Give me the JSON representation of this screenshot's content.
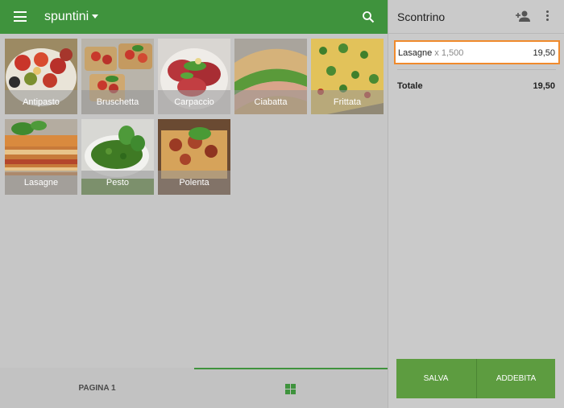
{
  "appbar": {
    "category": "spuntini"
  },
  "products": [
    {
      "name": "Antipasto"
    },
    {
      "name": "Bruschetta"
    },
    {
      "name": "Carpaccio"
    },
    {
      "name": "Ciabatta"
    },
    {
      "name": "Frittata"
    },
    {
      "name": "Lasagne"
    },
    {
      "name": "Pesto"
    },
    {
      "name": "Polenta"
    }
  ],
  "bottom": {
    "page_label": "PAGINA 1"
  },
  "receipt": {
    "title": "Scontrino",
    "items": [
      {
        "name": "Lasagne",
        "qty": "x 1,500",
        "price": "19,50"
      }
    ],
    "total_label": "Totale",
    "total_value": "19,50"
  },
  "actions": {
    "save_label": "SALVA",
    "charge_label": "ADDEBITA"
  },
  "colors": {
    "primary": "#3f933d",
    "accent": "#5d9c40",
    "highlight": "#f08a2c"
  }
}
